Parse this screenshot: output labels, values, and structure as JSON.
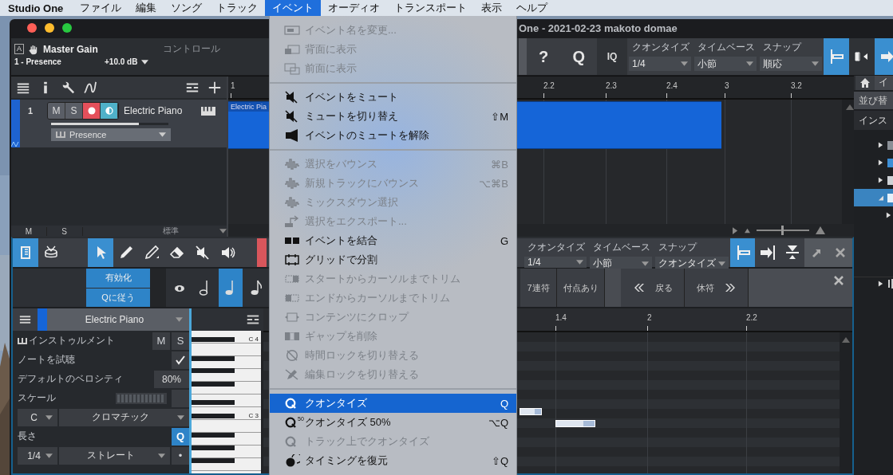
{
  "menu_bar": {
    "app_name": "Studio One",
    "menus": [
      {
        "label": "ファイル",
        "selected": false
      },
      {
        "label": "編集",
        "selected": false
      },
      {
        "label": "ソング",
        "selected": false
      },
      {
        "label": "トラック",
        "selected": false
      },
      {
        "label": "イベント",
        "selected": true
      },
      {
        "label": "オーディオ",
        "selected": false
      },
      {
        "label": "トランスポート",
        "selected": false
      },
      {
        "label": "表示",
        "selected": false
      },
      {
        "label": "ヘルプ",
        "selected": false
      }
    ]
  },
  "window": {
    "title": "One - 2021-02-23 makoto domae"
  },
  "toolbar": {
    "mode": "A",
    "control_name": "Master Gain",
    "section": "コントロール",
    "preset": "1 - Presence",
    "value": "+10.0 dB",
    "help": "?",
    "quantize_button": "Q",
    "iq_button": "IQ",
    "settings": [
      {
        "label": "クオンタイズ",
        "value": "1/4"
      },
      {
        "label": "タイムベース",
        "value": "小節"
      },
      {
        "label": "スナップ",
        "value": "順応"
      }
    ],
    "snap_buttons": [
      {
        "selected": true
      },
      {
        "selected": false
      },
      {
        "selected": true
      }
    ]
  },
  "track_list": {
    "tracks": [
      {
        "number": "1",
        "name": "Electric Piano",
        "mute": "M",
        "solo": "S",
        "record_armed": true,
        "monitor": true,
        "level": 0.75,
        "instrument": "Presence"
      }
    ],
    "footer": {
      "mute": "M",
      "solo": "S",
      "view": "標準"
    }
  },
  "arrange": {
    "ruler": [
      "1",
      "2.2",
      "2.3",
      "2.4",
      "3",
      "3.2"
    ],
    "events": [
      {
        "label": "Electric Pia"
      }
    ],
    "zoom": {
      "level": 0.5
    }
  },
  "browser": {
    "tabs": [
      {
        "label": "イ",
        "selected": true
      }
    ],
    "sort_label": "並び替",
    "category": "インス",
    "tree": [
      {
        "expanded": false,
        "selected": false
      },
      {
        "expanded": false,
        "selected": false
      },
      {
        "expanded": false,
        "selected": false
      },
      {
        "expanded": true,
        "selected": true
      }
    ]
  },
  "editor": {
    "tools": [
      {
        "selected": true
      },
      {
        "selected": false
      },
      {
        "selected": true
      },
      {
        "selected": false
      },
      {
        "selected": false
      },
      {
        "selected": false
      },
      {
        "selected": false
      },
      {
        "selected": false
      }
    ],
    "settings": [
      {
        "label": "クオンタイズ",
        "value": "1/4"
      },
      {
        "label": "タイムベース",
        "value": "小節"
      },
      {
        "label": "スナップ",
        "value": "クオンタイズ"
      }
    ],
    "snap_buttons": [
      {
        "selected": true
      },
      {
        "selected": false
      },
      {
        "selected": false
      }
    ],
    "step_input": {
      "enable": {
        "label": "有効化",
        "on": true
      },
      "follow_quantize": {
        "label": "Qに従う",
        "on": true
      },
      "notes": [
        {
          "selected": false
        },
        {
          "selected": false
        },
        {
          "selected": true
        },
        {
          "selected": false
        }
      ],
      "tuplet": "7連符",
      "dotted": "付点あり",
      "back": "戻る",
      "rest": "休符"
    },
    "inspector": {
      "track_name": "Electric Piano",
      "instrument_label": "インストゥルメント",
      "mute": "M",
      "solo": "S",
      "audition_label": "ノートを試聴",
      "audition": true,
      "velocity_label": "デフォルトのベロシティ",
      "velocity": "80%",
      "scale_label": "スケール",
      "root": "C",
      "scale": "クロマチック",
      "length_label": "長さ",
      "length_quantize": {
        "label": "Q",
        "on": true
      },
      "length": "1/4",
      "length_mode": "ストレート",
      "dot": "•"
    },
    "keys": [
      "C 4",
      "C 3"
    ],
    "ruler": [
      "1.4",
      "2",
      "2.2"
    ]
  },
  "event_menu": {
    "groups": [
      [
        {
          "label": "イベント名を変更...",
          "disabled": true,
          "selected": false
        },
        {
          "label": "背面に表示",
          "disabled": true,
          "selected": false
        },
        {
          "label": "前面に表示",
          "disabled": true,
          "selected": false
        }
      ],
      [
        {
          "label": "イベントをミュート",
          "disabled": false,
          "selected": false
        },
        {
          "label": "ミュートを切り替え",
          "shortcut": "⇧M",
          "disabled": false,
          "selected": false
        },
        {
          "label": "イベントのミュートを解除",
          "disabled": false,
          "selected": false
        }
      ],
      [
        {
          "label": "選択をバウンス",
          "shortcut": "⌘B",
          "disabled": true,
          "selected": false
        },
        {
          "label": "新規トラックにバウンス",
          "shortcut": "⌥⌘B",
          "disabled": true,
          "selected": false
        },
        {
          "label": "ミックスダウン選択",
          "disabled": true,
          "selected": false
        },
        {
          "label": "選択をエクスポート...",
          "disabled": true,
          "selected": false
        },
        {
          "label": "イベントを結合",
          "shortcut": "G",
          "disabled": false,
          "selected": false
        },
        {
          "label": "グリッドで分割",
          "disabled": false,
          "selected": false
        },
        {
          "label": "スタートからカーソルまでトリム",
          "disabled": true,
          "selected": false
        },
        {
          "label": "エンドからカーソルまでトリム",
          "disabled": true,
          "selected": false
        },
        {
          "label": "コンテンツにクロップ",
          "disabled": true,
          "selected": false
        },
        {
          "label": "ギャップを削除",
          "disabled": true,
          "selected": false
        },
        {
          "label": "時間ロックを切り替える",
          "disabled": true,
          "selected": false
        },
        {
          "label": "編集ロックを切り替える",
          "disabled": true,
          "selected": false
        }
      ],
      [
        {
          "label": "クオンタイズ",
          "shortcut": "Q",
          "disabled": false,
          "selected": true
        },
        {
          "label": "クオンタイズ 50%",
          "shortcut": "⌥Q",
          "badge": "50",
          "disabled": false,
          "selected": false
        },
        {
          "label": "トラック上でクオンタイズ",
          "disabled": true,
          "selected": false
        },
        {
          "label": "タイミングを復元",
          "shortcut": "⇧Q",
          "disabled": false,
          "selected": false
        }
      ]
    ]
  }
}
